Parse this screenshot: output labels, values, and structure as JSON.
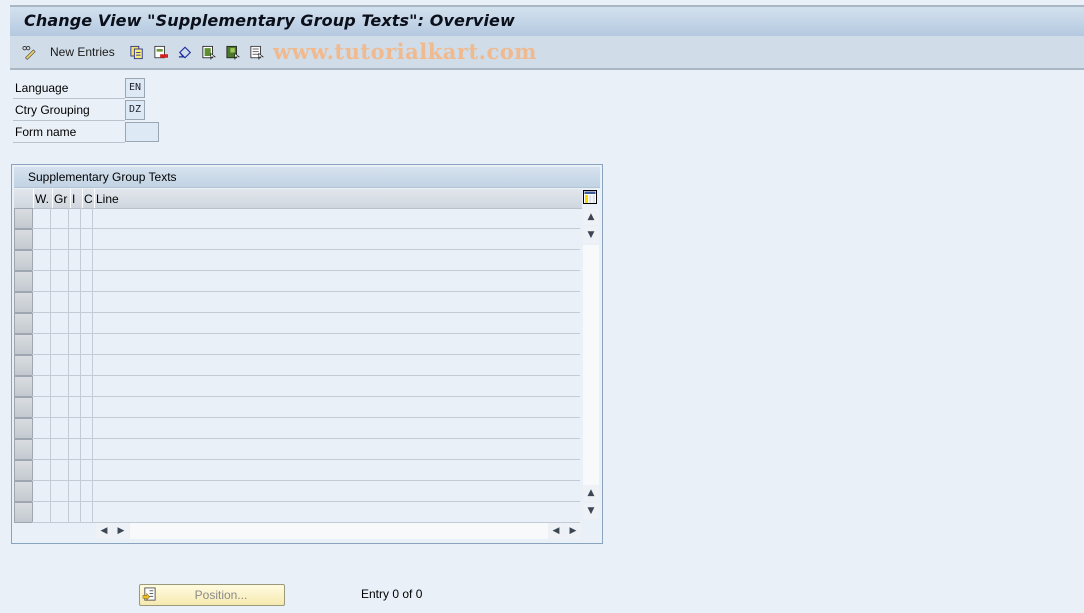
{
  "window": {
    "title": "Change View \"Supplementary Group Texts\": Overview"
  },
  "toolbar": {
    "items": [
      {
        "icon": "pencil-glasses-icon",
        "label": ""
      },
      {
        "icon": "",
        "label": "New Entries"
      },
      {
        "icon": "copy-icon",
        "label": ""
      },
      {
        "icon": "delete-icon",
        "label": ""
      },
      {
        "icon": "undo-icon",
        "label": ""
      },
      {
        "icon": "select-all-icon",
        "label": ""
      },
      {
        "icon": "select-block-icon",
        "label": ""
      },
      {
        "icon": "deselect-all-icon",
        "label": ""
      }
    ],
    "new_entries_label": "New Entries",
    "watermark": "www.tutorialkart.com"
  },
  "fields": {
    "language": {
      "label": "Language",
      "value": "EN"
    },
    "ctry_grouping": {
      "label": "Ctry Grouping",
      "value": "DZ"
    },
    "form_name": {
      "label": "Form name",
      "value": ""
    }
  },
  "table": {
    "title": "Supplementary Group Texts",
    "columns": [
      "W.",
      "Gr",
      "I",
      "C",
      "Line"
    ],
    "row_count": 15,
    "rows": []
  },
  "footer": {
    "position_button": "Position...",
    "entry_text": "Entry 0 of 0"
  }
}
